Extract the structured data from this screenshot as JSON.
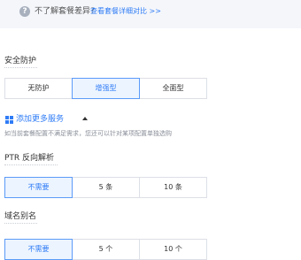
{
  "tip": {
    "text": "不了解套餐差异?",
    "link": "查看套餐详细对比 >>"
  },
  "security": {
    "label": "安全防护",
    "options": [
      "无防护",
      "增强型",
      "全面型"
    ],
    "selected": "增强型"
  },
  "more_services": {
    "label": "添加更多服务",
    "description": "如当前套餐配置不满足需求，您还可以针对某项配置单独选购"
  },
  "ptr": {
    "label": "PTR 反向解析",
    "options": [
      "不需要",
      "5 条",
      "10 条"
    ],
    "selected": "不需要"
  },
  "alias": {
    "label": "域名别名",
    "options": [
      "不需要",
      "5 个",
      "10 个"
    ],
    "selected": "不需要"
  },
  "colors": {
    "accent": "#2f7cf6",
    "active_bg": "#ecf4ff",
    "tip_bg": "#f4f6fa"
  }
}
